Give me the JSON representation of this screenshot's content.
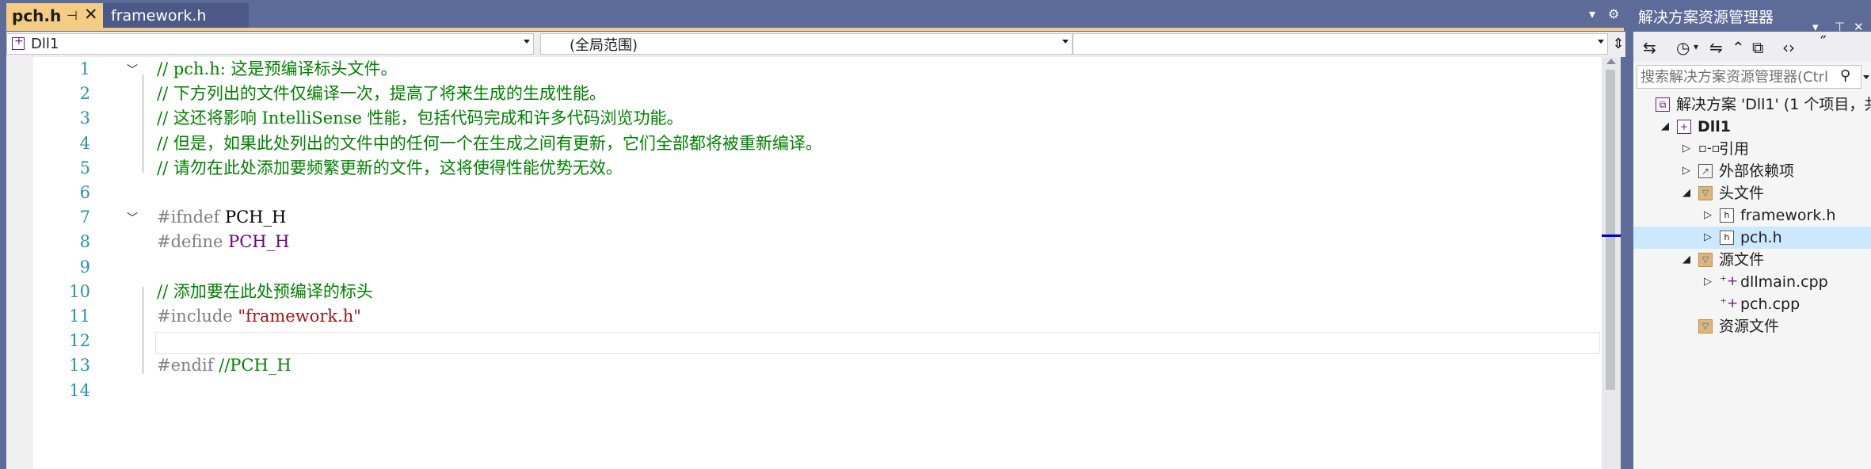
{
  "tabs": [
    {
      "label": "pch.h",
      "active": true,
      "pinned": true
    },
    {
      "label": "framework.h",
      "active": false
    }
  ],
  "nav": {
    "project": "Dll1",
    "scope": "(全局范围)",
    "member": ""
  },
  "code_lines": [
    {
      "n": "1",
      "fold": "open",
      "parts": [
        {
          "t": "// pch.h: 这是预编译标头文件。",
          "c": "c-comment"
        }
      ]
    },
    {
      "n": "2",
      "parts": [
        {
          "t": "// 下方列出的文件仅编译一次，提高了将来生成的生成性能。",
          "c": "c-comment"
        }
      ]
    },
    {
      "n": "3",
      "parts": [
        {
          "t": "// 这还将影响 IntelliSense 性能，包括代码完成和许多代码浏览功能。",
          "c": "c-comment"
        }
      ]
    },
    {
      "n": "4",
      "parts": [
        {
          "t": "// 但是，如果此处列出的文件中的任何一个在生成之间有更新，它们全部都将被重新编译。",
          "c": "c-comment"
        }
      ]
    },
    {
      "n": "5",
      "parts": [
        {
          "t": "// 请勿在此处添加要频繁更新的文件，这将使得性能优势无效。",
          "c": "c-comment"
        }
      ]
    },
    {
      "n": "6",
      "parts": []
    },
    {
      "n": "7",
      "fold": "open",
      "parts": [
        {
          "t": "#ifndef ",
          "c": "c-pre"
        },
        {
          "t": "PCH_H",
          "c": "c-macro"
        }
      ]
    },
    {
      "n": "8",
      "parts": [
        {
          "t": "#define ",
          "c": "c-pre"
        },
        {
          "t": "PCH_H",
          "c": "c-macro2"
        }
      ]
    },
    {
      "n": "9",
      "parts": []
    },
    {
      "n": "10",
      "parts": [
        {
          "t": "// 添加要在此处预编译的标头",
          "c": "c-comment"
        }
      ]
    },
    {
      "n": "11",
      "parts": [
        {
          "t": "#include ",
          "c": "c-pre"
        },
        {
          "t": "\"framework.h\"",
          "c": "c-str"
        }
      ]
    },
    {
      "n": "12",
      "parts": []
    },
    {
      "n": "13",
      "parts": [
        {
          "t": "#endif ",
          "c": "c-pre"
        },
        {
          "t": "//PCH_H",
          "c": "c-comment"
        }
      ]
    },
    {
      "n": "14",
      "parts": []
    }
  ],
  "solution_explorer": {
    "title": "解决方案资源管理器",
    "search_placeholder": "搜索解决方案资源管理器(Ctrl",
    "tree": [
      {
        "label": "解决方案 'Dll1' (1 个项目，共",
        "icon": "solution-icon",
        "depth": 0,
        "twisty": "",
        "bold": false
      },
      {
        "label": "Dll1",
        "icon": "project-icon",
        "depth": 1,
        "twisty": "expanded",
        "bold": true
      },
      {
        "label": "引用",
        "icon": "references-icon",
        "depth": 2,
        "twisty": "collapsed",
        "bold": false
      },
      {
        "label": "外部依赖项",
        "icon": "external-deps-icon",
        "depth": 2,
        "twisty": "collapsed",
        "bold": false
      },
      {
        "label": "头文件",
        "icon": "folder-filter-icon",
        "depth": 2,
        "twisty": "expanded",
        "bold": false
      },
      {
        "label": "framework.h",
        "icon": "header-file-icon",
        "depth": 3,
        "twisty": "collapsed",
        "bold": false
      },
      {
        "label": "pch.h",
        "icon": "header-file-icon",
        "depth": 3,
        "twisty": "collapsed",
        "bold": false,
        "selected": true
      },
      {
        "label": "源文件",
        "icon": "folder-filter-icon",
        "depth": 2,
        "twisty": "expanded",
        "bold": false
      },
      {
        "label": "dllmain.cpp",
        "icon": "cpp-file-icon",
        "depth": 3,
        "twisty": "collapsed",
        "bold": false
      },
      {
        "label": "pch.cpp",
        "icon": "cpp-file-icon",
        "depth": 3,
        "twisty": "",
        "bold": false
      },
      {
        "label": "资源文件",
        "icon": "folder-filter-icon",
        "depth": 2,
        "twisty": "",
        "bold": false
      }
    ]
  },
  "colors": {
    "chrome": "#5d6b99",
    "active_tab": "#f5cc84",
    "comment": "#008000",
    "line_number": "#2b91af",
    "selection": "#cce8ff"
  }
}
